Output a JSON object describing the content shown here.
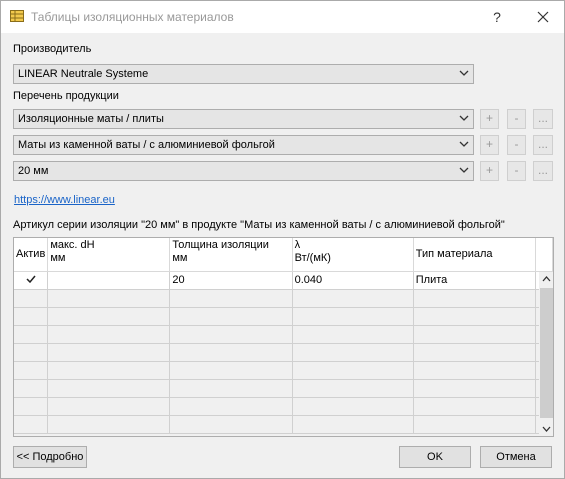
{
  "window": {
    "title": "Таблицы изоляционных материалов",
    "help_label": "?"
  },
  "manufacturer": {
    "label": "Производитель",
    "value": "LINEAR Neutrale Systeme"
  },
  "products": {
    "label": "Перечень продукции",
    "rows": [
      {
        "value": "Изоляционные маты / плиты"
      },
      {
        "value": "Маты из каменной ваты / с алюминиевой фольгой"
      },
      {
        "value": "20 мм"
      }
    ],
    "add_label": "+",
    "remove_label": "-",
    "more_label": "..."
  },
  "link": {
    "text": "https://www.linear.eu"
  },
  "article": {
    "label": "Артикул серии изоляции \"20 мм\" в продукте \"Маты из каменной ваты / с алюминиевой фольгой\"",
    "columns": [
      {
        "line1": "Актив",
        "line2": ""
      },
      {
        "line1": "макс. dH",
        "line2": "мм"
      },
      {
        "line1": "Толщина изоляции",
        "line2": "мм"
      },
      {
        "line1": "λ",
        "line2": "Вт/(мК)"
      },
      {
        "line1": "Тип материала",
        "line2": ""
      }
    ],
    "rows": [
      {
        "active": true,
        "max_dh": "",
        "thickness": "20",
        "lambda": "0.040",
        "type": "Плита"
      }
    ]
  },
  "buttons": {
    "details": "<< Подробно",
    "ok": "OK",
    "cancel": "Отмена"
  }
}
